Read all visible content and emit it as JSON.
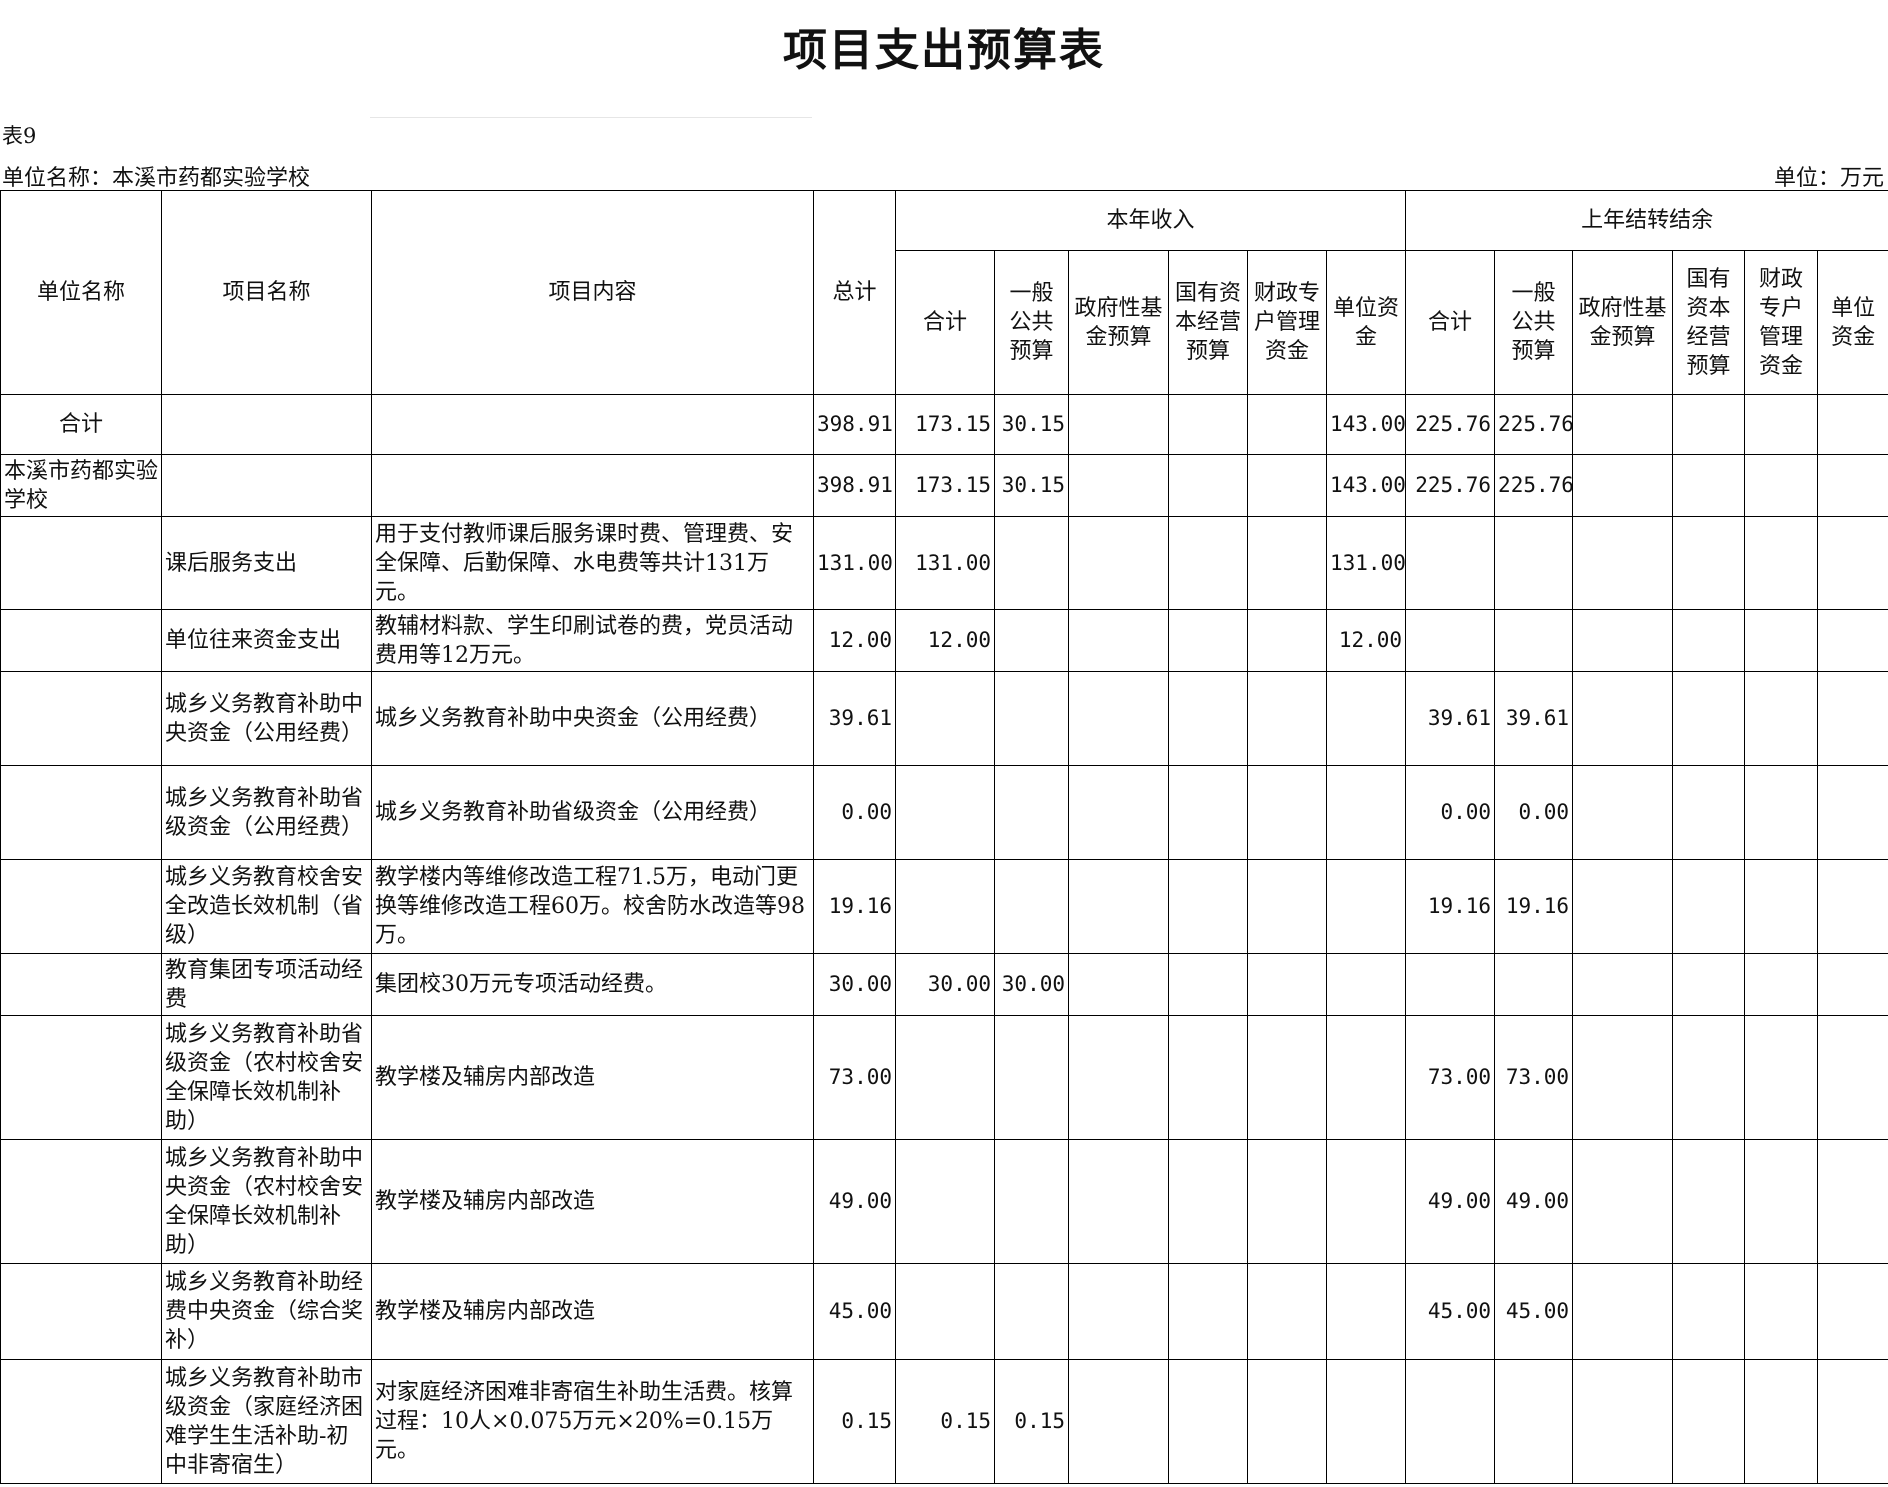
{
  "title": "项目支出预算表",
  "table_no": "表9",
  "unit_name": "单位名称：本溪市药都实验学校",
  "unit": "单位：万元",
  "headers": {
    "unit_name": "单位名称",
    "project_name": "项目名称",
    "project_content": "项目内容",
    "total": "总计",
    "current_year": "本年收入",
    "carryover": "上年结转结余",
    "current_cols": [
      "合计",
      "一般公共预算",
      "政府性基金预算",
      "国有资本经营预算",
      "财政专户管理资金",
      "单位资金"
    ],
    "carry_cols": [
      "合计",
      "一般公共预算",
      "政府性基金预算",
      "国有资本经营预算",
      "财政专户管理资金",
      "单位资金"
    ]
  },
  "rows": [
    {
      "unit": "合计",
      "name": "",
      "content": "",
      "total": "398.91",
      "c": [
        "173.15",
        "30.15",
        "",
        "",
        "",
        "143.00"
      ],
      "p": [
        "225.76",
        "225.76",
        "",
        "",
        "",
        ""
      ]
    },
    {
      "unit": "本溪市药都实验学校",
      "name": "",
      "content": "",
      "total": "398.91",
      "c": [
        "173.15",
        "30.15",
        "",
        "",
        "",
        "143.00"
      ],
      "p": [
        "225.76",
        "225.76",
        "",
        "",
        "",
        ""
      ]
    },
    {
      "unit": "",
      "name": "课后服务支出",
      "content": "用于支付教师课后服务课时费、管理费、安全保障、后勤保障、水电费等共计131万元。",
      "total": "131.00",
      "c": [
        "131.00",
        "",
        "",
        "",
        "",
        "131.00"
      ],
      "p": [
        "",
        "",
        "",
        "",
        "",
        ""
      ]
    },
    {
      "unit": "",
      "name": "单位往来资金支出",
      "content": "教辅材料款、学生印刷试卷的费，党员活动费用等12万元。",
      "total": "12.00",
      "c": [
        "12.00",
        "",
        "",
        "",
        "",
        "12.00"
      ],
      "p": [
        "",
        "",
        "",
        "",
        "",
        ""
      ]
    },
    {
      "unit": "",
      "name": "城乡义务教育补助中央资金（公用经费）",
      "content": "城乡义务教育补助中央资金（公用经费）",
      "total": "39.61",
      "c": [
        "",
        "",
        "",
        "",
        "",
        ""
      ],
      "p": [
        "39.61",
        "39.61",
        "",
        "",
        "",
        ""
      ]
    },
    {
      "unit": "",
      "name": "城乡义务教育补助省级资金（公用经费）",
      "content": "城乡义务教育补助省级资金（公用经费）",
      "total": "0.00",
      "c": [
        "",
        "",
        "",
        "",
        "",
        ""
      ],
      "p": [
        "0.00",
        "0.00",
        "",
        "",
        "",
        ""
      ]
    },
    {
      "unit": "",
      "name": "城乡义务教育校舍安全改造长效机制（省级）",
      "content": "教学楼内等维修改造工程71.5万，电动门更换等维修改造工程60万。校舍防水改造等98万。",
      "total": "19.16",
      "c": [
        "",
        "",
        "",
        "",
        "",
        ""
      ],
      "p": [
        "19.16",
        "19.16",
        "",
        "",
        "",
        ""
      ]
    },
    {
      "unit": "",
      "name": "教育集团专项活动经费",
      "content": "集团校30万元专项活动经费。",
      "total": "30.00",
      "c": [
        "30.00",
        "30.00",
        "",
        "",
        "",
        ""
      ],
      "p": [
        "",
        "",
        "",
        "",
        "",
        ""
      ]
    },
    {
      "unit": "",
      "name": "城乡义务教育补助省级资金（农村校舍安全保障长效机制补助）",
      "content": "教学楼及辅房内部改造",
      "total": "73.00",
      "c": [
        "",
        "",
        "",
        "",
        "",
        ""
      ],
      "p": [
        "73.00",
        "73.00",
        "",
        "",
        "",
        ""
      ]
    },
    {
      "unit": "",
      "name": "城乡义务教育补助中央资金（农村校舍安全保障长效机制补助）",
      "content": "教学楼及辅房内部改造",
      "total": "49.00",
      "c": [
        "",
        "",
        "",
        "",
        "",
        ""
      ],
      "p": [
        "49.00",
        "49.00",
        "",
        "",
        "",
        ""
      ]
    },
    {
      "unit": "",
      "name": "城乡义务教育补助经费中央资金（综合奖补）",
      "content": "教学楼及辅房内部改造",
      "total": "45.00",
      "c": [
        "",
        "",
        "",
        "",
        "",
        ""
      ],
      "p": [
        "45.00",
        "45.00",
        "",
        "",
        "",
        ""
      ]
    },
    {
      "unit": "",
      "name": "城乡义务教育补助市级资金（家庭经济困难学生生活补助-初中非寄宿生）",
      "content": "对家庭经济困难非寄宿生补助生活费。核算过程：10人×0.075万元×20%=0.15万元。",
      "total": "0.15",
      "c": [
        "0.15",
        "0.15",
        "",
        "",
        "",
        ""
      ],
      "p": [
        "",
        "",
        "",
        "",
        "",
        ""
      ]
    }
  ]
}
